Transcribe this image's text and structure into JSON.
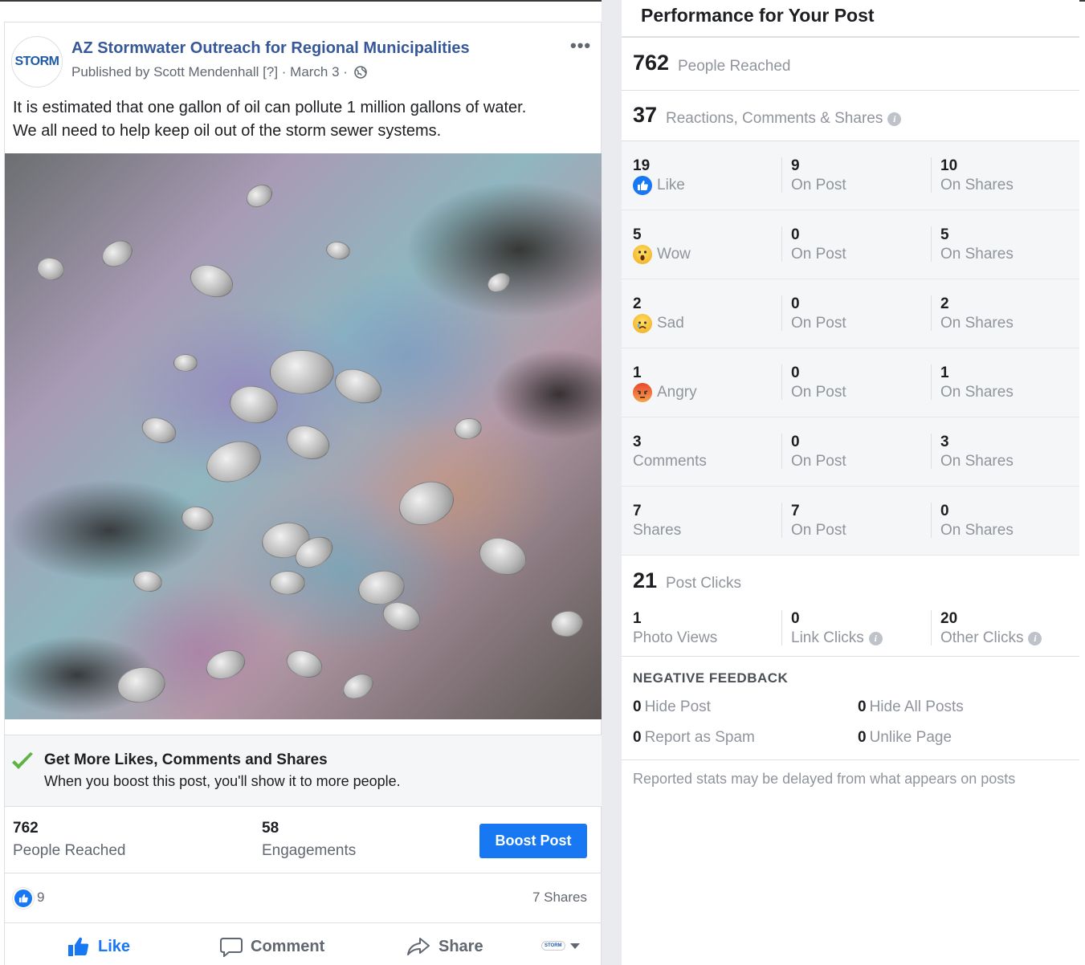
{
  "post": {
    "page_name": "AZ Stormwater Outreach for Regional Municipalities",
    "avatar_text": "STORM",
    "byline": "Published by Scott Mendenhall [?] · March 3 ·",
    "text_line1": "It is estimated that one gallon of oil can pollute 1 million gallons of water.",
    "text_line2": "We all need to help keep oil out of the storm sewer systems.",
    "image_description": "oil-sheen-on-water-photo",
    "boost_banner": {
      "title": "Get More Likes, Comments and Shares",
      "subtitle": "When you boost this post, you'll show it to more people."
    },
    "stats": {
      "reached_value": "762",
      "reached_label": "People Reached",
      "engagements_value": "58",
      "engagements_label": "Engagements",
      "boost_button": "Boost Post"
    },
    "reactions": {
      "like_count": "9",
      "shares": "7 Shares"
    },
    "actions": {
      "like": "Like",
      "comment": "Comment",
      "share": "Share",
      "mini_logo": "STORM"
    }
  },
  "performance": {
    "title": "Performance for Your Post",
    "people_reached_value": "762",
    "people_reached_label": "People Reached",
    "rcs_value": "37",
    "rcs_label": "Reactions, Comments & Shares",
    "rows": [
      {
        "total": "19",
        "label": "Like",
        "icon": "like-icon",
        "on_post": "9",
        "on_post_label": "On Post",
        "on_shares": "10",
        "on_shares_label": "On Shares"
      },
      {
        "total": "5",
        "label": "Wow",
        "icon": "wow-icon",
        "on_post": "0",
        "on_post_label": "On Post",
        "on_shares": "5",
        "on_shares_label": "On Shares"
      },
      {
        "total": "2",
        "label": "Sad",
        "icon": "sad-icon",
        "on_post": "0",
        "on_post_label": "On Post",
        "on_shares": "2",
        "on_shares_label": "On Shares"
      },
      {
        "total": "1",
        "label": "Angry",
        "icon": "angry-icon",
        "on_post": "0",
        "on_post_label": "On Post",
        "on_shares": "1",
        "on_shares_label": "On Shares"
      },
      {
        "total": "3",
        "label": "Comments",
        "icon": "",
        "on_post": "0",
        "on_post_label": "On Post",
        "on_shares": "3",
        "on_shares_label": "On Shares"
      },
      {
        "total": "7",
        "label": "Shares",
        "icon": "",
        "on_post": "7",
        "on_post_label": "On Post",
        "on_shares": "0",
        "on_shares_label": "On Shares"
      }
    ],
    "post_clicks_value": "21",
    "post_clicks_label": "Post Clicks",
    "clicks": {
      "photo_views_value": "1",
      "photo_views_label": "Photo Views",
      "link_clicks_value": "0",
      "link_clicks_label": "Link Clicks",
      "other_clicks_value": "20",
      "other_clicks_label": "Other Clicks"
    },
    "negative": {
      "title": "NEGATIVE FEEDBACK",
      "hide_post_value": "0",
      "hide_post_label": "Hide Post",
      "hide_all_value": "0",
      "hide_all_label": "Hide All Posts",
      "spam_value": "0",
      "spam_label": "Report as Spam",
      "unlike_value": "0",
      "unlike_label": "Unlike Page"
    },
    "footnote": "Reported stats may be delayed from what appears on posts"
  },
  "colors": {
    "accent": "#1877f2",
    "page_name": "#365899",
    "muted": "#90949c"
  }
}
